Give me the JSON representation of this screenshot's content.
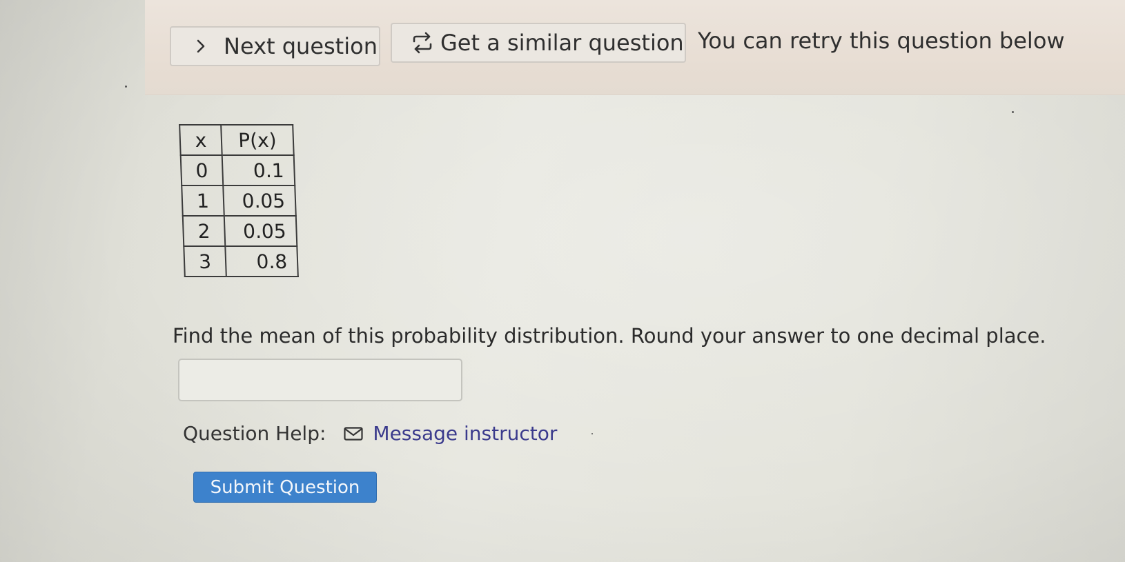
{
  "banner": {
    "next_button_label": "Next question",
    "similar_button_label": "Get a similar question",
    "retry_text": "You can retry this question below",
    "icons": {
      "next": "chevron-right-icon",
      "similar": "repeat-icon"
    }
  },
  "table": {
    "headers": [
      "x",
      "P(x)"
    ],
    "rows": [
      {
        "x": "0",
        "p": "0.1"
      },
      {
        "x": "1",
        "p": "0.05"
      },
      {
        "x": "2",
        "p": "0.05"
      },
      {
        "x": "3",
        "p": "0.8"
      }
    ]
  },
  "question": {
    "prompt": "Find the mean of this probability distribution. Round your answer to one decimal place.",
    "answer_value": ""
  },
  "help": {
    "label": "Question Help:",
    "link_label": "Message instructor",
    "link_icon": "mail-icon"
  },
  "submit": {
    "label": "Submit Question"
  },
  "colors": {
    "submit_bg": "#3d82cc",
    "link": "#3a3a8c",
    "banner_bg": "#e7ddd3",
    "page_bg": "#e6e6df"
  }
}
